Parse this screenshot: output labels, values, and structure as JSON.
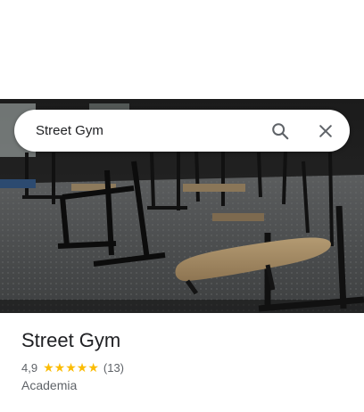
{
  "search": {
    "query": "Street Gym",
    "search_icon": "search-icon",
    "close_icon": "close-icon"
  },
  "photo": {
    "subject": "gym-interior-photo"
  },
  "place": {
    "name": "Street Gym",
    "rating": "4,9",
    "stars": 5,
    "review_count": "(13)",
    "category": "Academia"
  },
  "colors": {
    "star": "#fbbc04",
    "text_primary": "#202124",
    "text_secondary": "#5f6368"
  }
}
